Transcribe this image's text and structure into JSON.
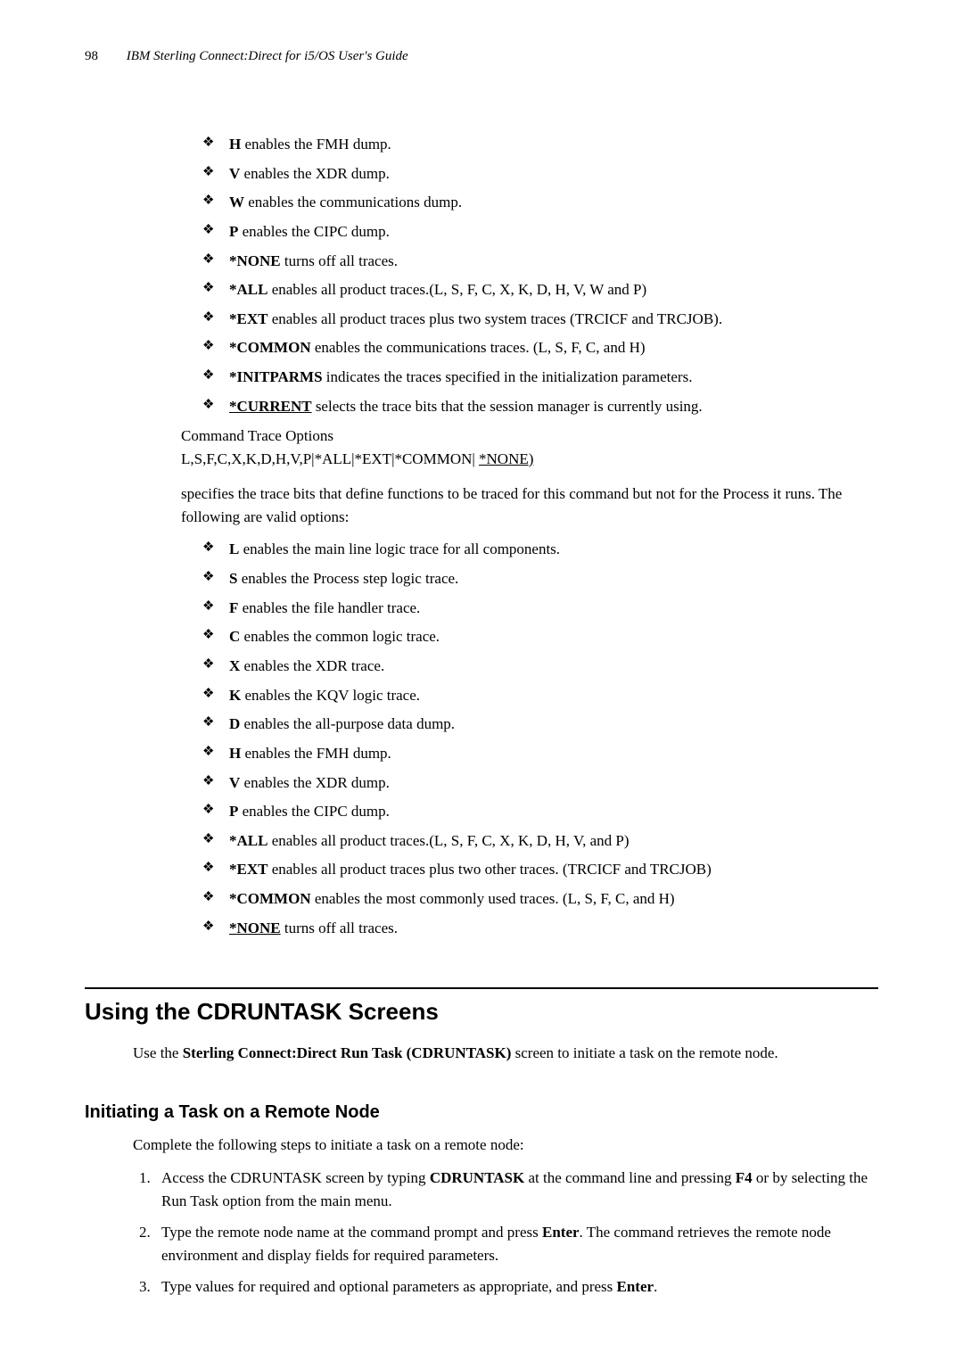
{
  "header": {
    "page_number": "98",
    "doc_title": "IBM Sterling Connect:Direct for i5/OS User's Guide"
  },
  "list1": [
    {
      "bold": "H",
      "rest": " enables the FMH dump."
    },
    {
      "bold": "V",
      "rest": " enables the XDR dump."
    },
    {
      "bold": "W",
      "rest": " enables the communications dump."
    },
    {
      "bold": "P",
      "rest": " enables the CIPC dump."
    },
    {
      "bold": "*NONE",
      "rest": " turns off all traces."
    },
    {
      "bold": "*ALL",
      "rest": " enables all product traces.(L, S, F, C, X, K, D, H, V, W and P)"
    },
    {
      "bold": "*EXT",
      "rest": " enables all product traces plus two system traces (TRCICF and TRCJOB)."
    },
    {
      "bold": "*COMMON",
      "rest": " enables the communications traces. (L, S, F, C, and H)"
    },
    {
      "bold": "*INITPARMS",
      "rest": " indicates the traces specified in the initialization parameters."
    },
    {
      "bold": "*CURRENT",
      "underline": true,
      "rest": " selects the trace bits that the session manager is currently using."
    }
  ],
  "cmd_trace_label": "Command Trace Options",
  "cmd_trace_options_prefix": " L,S,F,C,X,K,D,H,V,P|*ALL|*EXT|*COMMON| ",
  "cmd_trace_options_default": "*NONE)",
  "cmd_trace_desc": "specifies the trace bits that define functions to be traced for this command but not for the Process it runs. The following are valid options:",
  "list2": [
    {
      "bold": "L",
      "rest": " enables the main line logic trace for all components."
    },
    {
      "bold": "S",
      "rest": " enables the Process step logic trace."
    },
    {
      "bold": "F",
      "rest": " enables the file handler trace."
    },
    {
      "bold": "C",
      "rest": " enables the common logic trace."
    },
    {
      "bold": "X",
      "rest": " enables the XDR trace."
    },
    {
      "bold": "K",
      "rest": " enables the KQV logic trace."
    },
    {
      "bold": "D",
      "rest": " enables the all-purpose data dump."
    },
    {
      "bold": "H",
      "rest": " enables the FMH dump."
    },
    {
      "bold": "V",
      "rest": " enables the XDR dump."
    },
    {
      "bold": "P",
      "rest": " enables the CIPC dump."
    },
    {
      "bold": "*ALL",
      "rest": " enables all product traces.(L, S, F, C, X, K, D, H, V, and P)"
    },
    {
      "bold": "*EXT",
      "rest": " enables all product traces plus two other traces. (TRCICF and TRCJOB)"
    },
    {
      "bold": "*COMMON",
      "rest": " enables the most commonly used traces. (L, S, F, C, and H)"
    },
    {
      "bold": "*NONE",
      "underline": true,
      "rest": " turns off all traces."
    }
  ],
  "section": {
    "heading": "Using the CDRUNTASK Screens",
    "intro_pre": "Use the ",
    "intro_bold": "Sterling Connect:Direct Run Task (CDRUNTASK)",
    "intro_post": " screen to initiate a task on the remote node."
  },
  "subsection": {
    "heading": "Initiating a Task on a Remote Node",
    "intro": "Complete the following steps to initiate a task on a remote node:",
    "steps": {
      "s1_pre": "Access the CDRUNTASK screen by typing ",
      "s1_b1": "CDRUNTASK",
      "s1_mid": " at the command line and pressing ",
      "s1_b2": "F4",
      "s1_post": " or by selecting the Run Task option from the main menu.",
      "s2_pre": "Type the remote node name at the command prompt and press ",
      "s2_b1": "Enter",
      "s2_post": ". The command retrieves the remote node environment and display fields for required parameters.",
      "s3_pre": "Type values for required and optional parameters as appropriate, and press ",
      "s3_b1": "Enter",
      "s3_post": "."
    }
  }
}
